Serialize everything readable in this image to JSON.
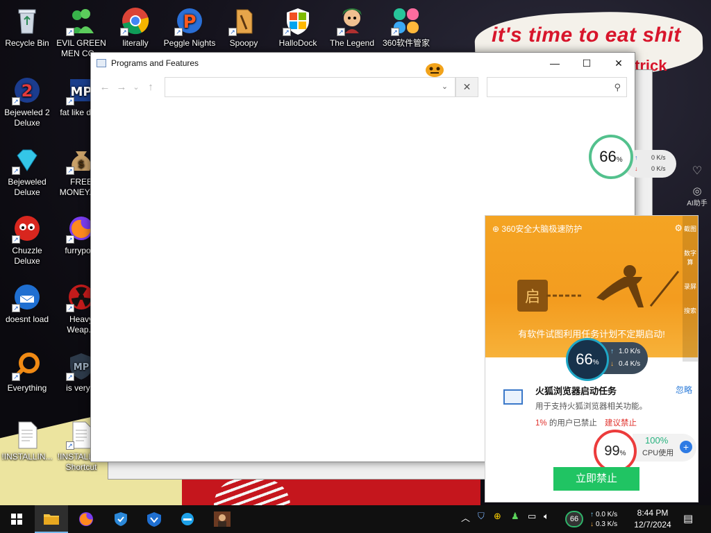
{
  "desktop": {
    "wallpaper_text": "it's time to eat shit",
    "wallpaper_text2": "trick",
    "icons": [
      {
        "label": "Recycle Bin",
        "icon": "recycle-bin-icon"
      },
      {
        "label": "EVIL GREEN MEN CO...",
        "icon": "green-men-icon"
      },
      {
        "label": "literally",
        "icon": "chrome-icon"
      },
      {
        "label": "Peggle Nights",
        "icon": "peggle-icon"
      },
      {
        "label": "Spoopy",
        "icon": "folder-icon"
      },
      {
        "label": "HalloDock",
        "icon": "windows-logo-icon"
      },
      {
        "label": "The Legend",
        "icon": "legend-icon"
      },
      {
        "label": "360软件管家",
        "icon": "360-software-manager-icon"
      },
      {
        "label": "Bejeweled 2 Deluxe",
        "icon": "bejeweled2-icon"
      },
      {
        "label": "fat like da...",
        "icon": "mp-icon"
      },
      {
        "label": "Bejeweled Deluxe",
        "icon": "diamond-icon"
      },
      {
        "label": "FREE MONEY.e...",
        "icon": "money-bag-icon"
      },
      {
        "label": "Chuzzle Deluxe",
        "icon": "chuzzle-icon"
      },
      {
        "label": "furrypo...",
        "icon": "firefox-icon"
      },
      {
        "label": "doesnt load",
        "icon": "thunderbird-icon"
      },
      {
        "label": "Heavy Weap...",
        "icon": "radiation-icon"
      },
      {
        "label": "Everything",
        "icon": "search-magnifier-icon"
      },
      {
        "label": "is very...",
        "icon": "shield-mp-icon"
      },
      {
        "label": "!INSTALLIN...",
        "icon": "document-icon"
      },
      {
        "label": "!INSTALL... - Shortcut",
        "icon": "document-icon"
      }
    ]
  },
  "window": {
    "title": "Programs and Features",
    "address_value": "",
    "search_placeholder": "",
    "controls": {
      "minimize": "—",
      "maximize": "☐",
      "close": "✕"
    },
    "nav": {
      "back": "←",
      "forward": "→",
      "recent": "⌄",
      "up": "↑"
    }
  },
  "speed_widget": {
    "percent": "66",
    "percent_unit": "%",
    "up": "0 K/s",
    "down": "0 K/s"
  },
  "side_strip": {
    "items": [
      "AI助手",
      "截图",
      "数字算",
      "录屏",
      "搜索"
    ]
  },
  "popup": {
    "header": "360安全大脑极速防护",
    "hero_message": "有软件试图利用任务计划不定期启动!",
    "lock_glyph": "启",
    "ring": {
      "percent": "66",
      "unit": "%",
      "up": "1.0 K/s",
      "down": "0.4 K/s"
    },
    "task_title": "火狐浏览器启动任务",
    "ignore": "忽略",
    "task_desc": "用于支持火狐浏览器相关功能。",
    "users_pct": "1%",
    "users_text": "的用户已禁止",
    "recommend": "建议禁止",
    "cpu": {
      "percent": "99",
      "unit": "%",
      "usage_pct": "100%",
      "usage_label": "CPU使用"
    },
    "ban_button": "立即禁止"
  },
  "taskbar": {
    "tray": {
      "up": "0.0 K/s",
      "down": "0.3 K/s",
      "speed_badge": "66"
    },
    "time": "8:44 PM",
    "date": "12/7/2024"
  },
  "colors": {
    "accent_orange": "#f4a423",
    "ban_green": "#20c463",
    "warn_red": "#e0302b",
    "link_blue": "#2a7ad8"
  }
}
